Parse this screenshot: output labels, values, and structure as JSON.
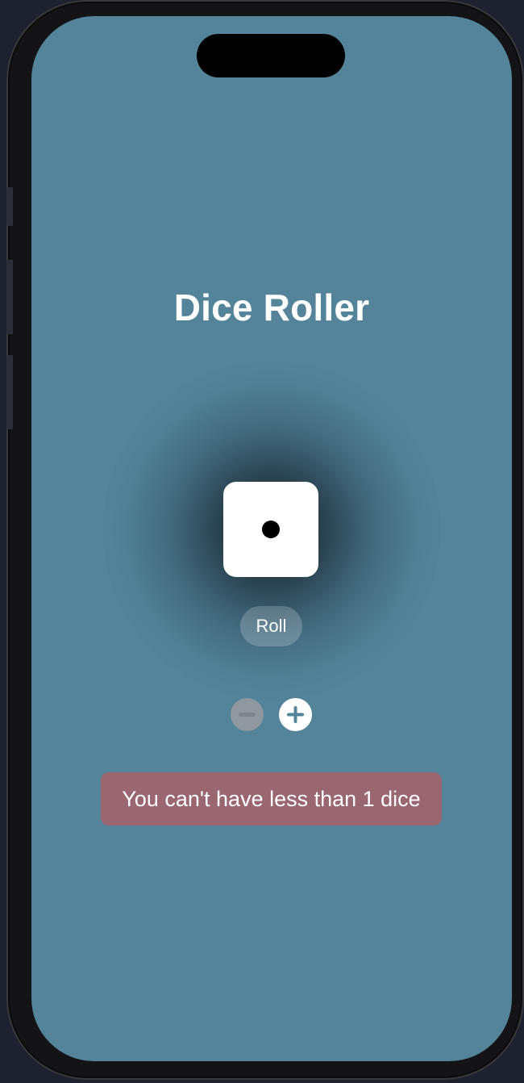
{
  "app": {
    "title": "Dice Roller"
  },
  "dice": {
    "count": 1,
    "values": [
      1
    ]
  },
  "controls": {
    "roll_label": "Roll",
    "decrement_icon": "minus-circle-icon",
    "increment_icon": "plus-circle-icon",
    "decrement_enabled": false,
    "increment_enabled": true
  },
  "error": {
    "message": "You can't have less than 1 dice"
  },
  "colors": {
    "background": "#53849a",
    "error_background": "#9a6670",
    "accent": "#ffffff",
    "disabled": "#8f989e"
  }
}
